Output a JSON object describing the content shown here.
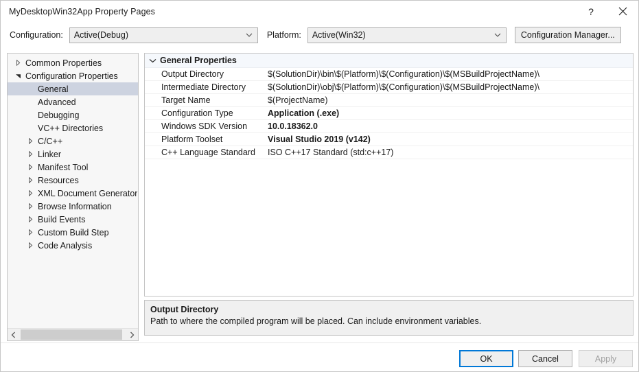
{
  "window": {
    "title": "MyDesktopWin32App Property Pages",
    "help_glyph": "?",
    "close_glyph": "close-icon"
  },
  "configbar": {
    "configuration_label": "Configuration:",
    "configuration_value": "Active(Debug)",
    "platform_label": "Platform:",
    "platform_value": "Active(Win32)",
    "configuration_manager_label": "Configuration Manager..."
  },
  "tree": {
    "nodes": [
      {
        "label": "Common Properties",
        "indent": 0,
        "state": "collapsed",
        "selected": false
      },
      {
        "label": "Configuration Properties",
        "indent": 0,
        "state": "expanded",
        "selected": false
      },
      {
        "label": "General",
        "indent": 1,
        "state": "leaf",
        "selected": true
      },
      {
        "label": "Advanced",
        "indent": 1,
        "state": "leaf",
        "selected": false
      },
      {
        "label": "Debugging",
        "indent": 1,
        "state": "leaf",
        "selected": false
      },
      {
        "label": "VC++ Directories",
        "indent": 1,
        "state": "leaf",
        "selected": false
      },
      {
        "label": "C/C++",
        "indent": 1,
        "state": "collapsed",
        "selected": false
      },
      {
        "label": "Linker",
        "indent": 1,
        "state": "collapsed",
        "selected": false
      },
      {
        "label": "Manifest Tool",
        "indent": 1,
        "state": "collapsed",
        "selected": false
      },
      {
        "label": "Resources",
        "indent": 1,
        "state": "collapsed",
        "selected": false
      },
      {
        "label": "XML Document Generator",
        "indent": 1,
        "state": "collapsed",
        "selected": false
      },
      {
        "label": "Browse Information",
        "indent": 1,
        "state": "collapsed",
        "selected": false
      },
      {
        "label": "Build Events",
        "indent": 1,
        "state": "collapsed",
        "selected": false
      },
      {
        "label": "Custom Build Step",
        "indent": 1,
        "state": "collapsed",
        "selected": false
      },
      {
        "label": "Code Analysis",
        "indent": 1,
        "state": "collapsed",
        "selected": false
      }
    ],
    "scrollbar": {
      "left_arrow": "chevron-left-icon",
      "right_arrow": "chevron-right-icon"
    }
  },
  "grid": {
    "section_title": "General Properties",
    "section_state": "expanded",
    "rows": [
      {
        "name": "Output Directory",
        "value": "$(SolutionDir)\\bin\\$(Platform)\\$(Configuration)\\$(MSBuildProjectName)\\",
        "bold": false
      },
      {
        "name": "Intermediate Directory",
        "value": "$(SolutionDir)\\obj\\$(Platform)\\$(Configuration)\\$(MSBuildProjectName)\\",
        "bold": false
      },
      {
        "name": "Target Name",
        "value": "$(ProjectName)",
        "bold": false
      },
      {
        "name": "Configuration Type",
        "value": "Application (.exe)",
        "bold": true
      },
      {
        "name": "Windows SDK Version",
        "value": "10.0.18362.0",
        "bold": true
      },
      {
        "name": "Platform Toolset",
        "value": "Visual Studio 2019 (v142)",
        "bold": true
      },
      {
        "name": "C++ Language Standard",
        "value": "ISO C++17 Standard (std:c++17)",
        "bold": false
      }
    ]
  },
  "description": {
    "title": "Output Directory",
    "text": "Path to where the compiled program will be placed. Can include environment variables."
  },
  "footer": {
    "ok_label": "OK",
    "cancel_label": "Cancel",
    "apply_label": "Apply",
    "apply_enabled": false
  },
  "colors": {
    "focus_border": "#0078d7",
    "selection": "#cdd3e0",
    "control_face": "#efefef",
    "control_border": "#adadad",
    "disabled_text": "#a0a0a0"
  }
}
